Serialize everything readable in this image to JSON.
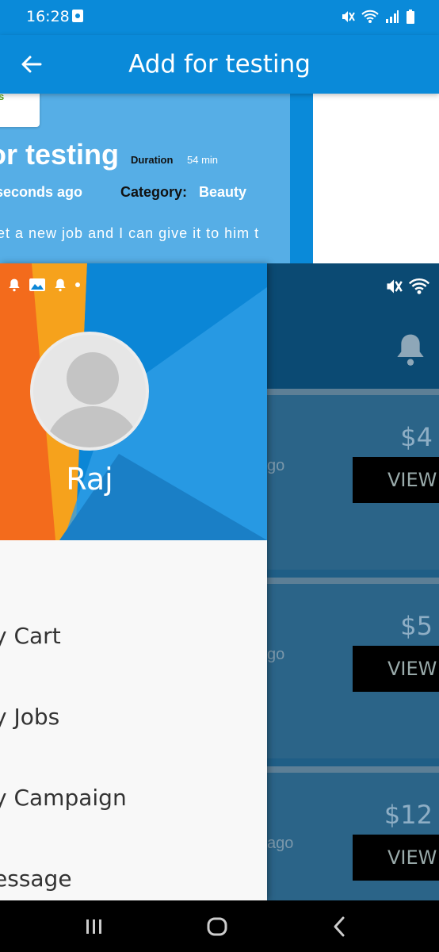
{
  "status_bar": {
    "time": "16:28"
  },
  "app_bar": {
    "title": "Add for testing"
  },
  "job": {
    "tag_text": "s",
    "title": "or testing",
    "duration_label": "Duration",
    "duration_value": "54 min",
    "posted_ago": "seconds ago",
    "category_label": "Category:",
    "category_value": "Beauty",
    "description": "et a new job and I can give it to him t"
  },
  "drawer": {
    "username": "Raj",
    "menu_items": [
      {
        "label": "y Cart"
      },
      {
        "label": "y Jobs"
      },
      {
        "label": "y Campaign"
      },
      {
        "label": "essage"
      }
    ]
  },
  "background_list": {
    "cards": [
      {
        "price": "$4",
        "ago": "go",
        "button": "VIEW"
      },
      {
        "price": "$5",
        "ago": "go",
        "button": "VIEW"
      },
      {
        "price": "$12",
        "ago": "ago",
        "button": "VIEW"
      }
    ]
  },
  "colors": {
    "primary": "#0a8ad9",
    "hero": "#56aee6",
    "accent_green": "#5aa01e",
    "dim_overlay": "#1f5e86"
  }
}
